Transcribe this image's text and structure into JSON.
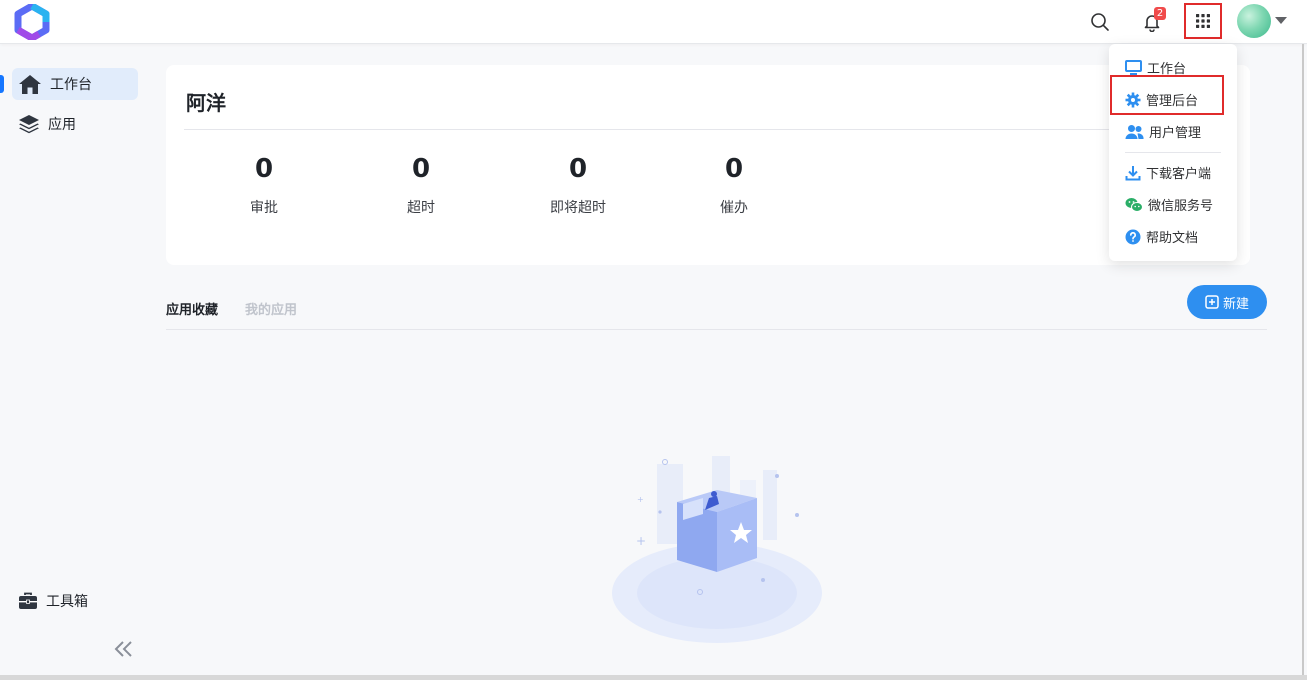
{
  "header": {
    "notification_count": "2",
    "icons": [
      "logo",
      "search-icon",
      "bell-icon",
      "apps-grid-icon",
      "avatar",
      "caret-down-icon"
    ]
  },
  "sidebar": {
    "items": [
      {
        "label": "工作台",
        "icon": "home-icon",
        "active": true
      },
      {
        "label": "应用",
        "icon": "layers-icon"
      }
    ],
    "toolbox_label": "工具箱",
    "collapse_icon": "double-chevron-left-icon"
  },
  "summary": {
    "name": "阿洋",
    "stats": [
      {
        "value": "0",
        "label": "审批"
      },
      {
        "value": "0",
        "label": "超时"
      },
      {
        "value": "0",
        "label": "即将超时"
      },
      {
        "value": "0",
        "label": "催办"
      }
    ]
  },
  "tabs": {
    "favorites": "应用收藏",
    "my_apps": "我的应用",
    "new_button": "新建"
  },
  "menu": {
    "items": [
      {
        "label": "工作台",
        "icon": "monitor-icon"
      },
      {
        "label": "管理后台",
        "icon": "gear-icon"
      },
      {
        "label": "用户管理",
        "icon": "users-icon"
      },
      {
        "label": "下载客户端",
        "icon": "download-icon"
      },
      {
        "label": "微信服务号",
        "icon": "wechat-icon"
      },
      {
        "label": "帮助文档",
        "icon": "help-icon"
      }
    ]
  },
  "colors": {
    "accent": "#1677ff",
    "button": "#2e8ff0",
    "badge": "#f04b4b",
    "highlight": "#e02b2b",
    "wechat": "#2aae67"
  }
}
